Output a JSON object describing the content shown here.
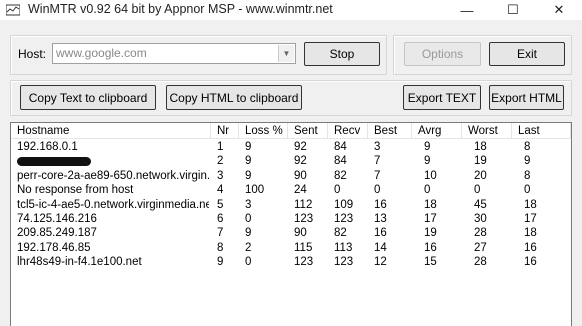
{
  "window": {
    "title": "WinMTR v0.92 64 bit by Appnor MSP - www.winmtr.net",
    "minimize_glyph": "—",
    "maximize_glyph": "☐",
    "close_glyph": "✕"
  },
  "host": {
    "label": "Host:",
    "value": "www.google.com"
  },
  "buttons": {
    "stop": "Stop",
    "options": "Options",
    "exit": "Exit",
    "copy_text": "Copy Text to clipboard",
    "copy_html": "Copy HTML to clipboard",
    "export_text": "Export TEXT",
    "export_html": "Export HTML"
  },
  "table": {
    "columns": [
      "Hostname",
      "Nr",
      "Loss %",
      "Sent",
      "Recv",
      "Best",
      "Avrg",
      "Worst",
      "Last"
    ],
    "rows": [
      {
        "hostname": "192.168.0.1",
        "nr": "1",
        "loss": "9",
        "sent": "92",
        "recv": "84",
        "best": "3",
        "avrg": "9",
        "worst": "18",
        "last": "8"
      },
      {
        "hostname": "",
        "redacted": true,
        "nr": "2",
        "loss": "9",
        "sent": "92",
        "recv": "84",
        "best": "7",
        "avrg": "9",
        "worst": "19",
        "last": "9"
      },
      {
        "hostname": "perr-core-2a-ae89-650.network.virgin...",
        "nr": "3",
        "loss": "9",
        "sent": "90",
        "recv": "82",
        "best": "7",
        "avrg": "10",
        "worst": "20",
        "last": "8"
      },
      {
        "hostname": "No response from host",
        "nr": "4",
        "loss": "100",
        "sent": "24",
        "recv": "0",
        "best": "0",
        "avrg": "0",
        "worst": "0",
        "last": "0"
      },
      {
        "hostname": "tcl5-ic-4-ae5-0.network.virginmedia.net",
        "nr": "5",
        "loss": "3",
        "sent": "112",
        "recv": "109",
        "best": "16",
        "avrg": "18",
        "worst": "45",
        "last": "18"
      },
      {
        "hostname": "74.125.146.216",
        "nr": "6",
        "loss": "0",
        "sent": "123",
        "recv": "123",
        "best": "13",
        "avrg": "17",
        "worst": "30",
        "last": "17"
      },
      {
        "hostname": "209.85.249.187",
        "nr": "7",
        "loss": "9",
        "sent": "90",
        "recv": "82",
        "best": "16",
        "avrg": "19",
        "worst": "28",
        "last": "18"
      },
      {
        "hostname": "192.178.46.85",
        "nr": "8",
        "loss": "2",
        "sent": "115",
        "recv": "113",
        "best": "14",
        "avrg": "16",
        "worst": "27",
        "last": "16"
      },
      {
        "hostname": "lhr48s49-in-f4.1e100.net",
        "nr": "9",
        "loss": "0",
        "sent": "123",
        "recv": "123",
        "best": "12",
        "avrg": "15",
        "worst": "28",
        "last": "16"
      }
    ]
  }
}
